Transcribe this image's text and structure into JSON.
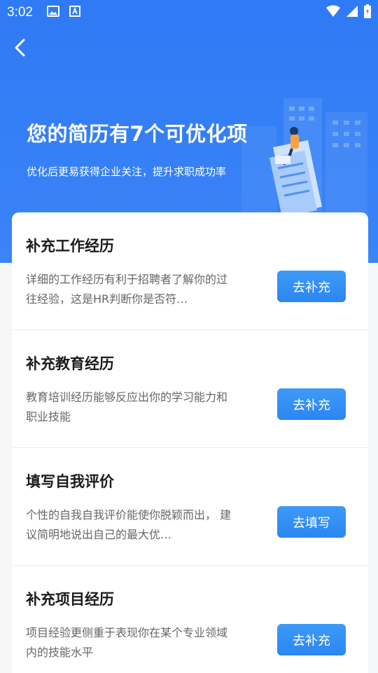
{
  "status_bar": {
    "time": "3:02"
  },
  "hero": {
    "title": "您的简历有7个可优化项",
    "subtitle": "优化后更易获得企业关注，提升求职成功率"
  },
  "items": [
    {
      "title": "补充工作经历",
      "desc": "详细的工作经历有利于招聘者了解你的过往经验，这是HR判断你是否符…",
      "button": "去补充"
    },
    {
      "title": "补充教育经历",
      "desc": "教育培训经历能够反应出你的学习能力和职业技能",
      "button": "去补充"
    },
    {
      "title": "填写自我评价",
      "desc": "个性的自我自我评价能使你脱颖而出， 建议简明地说出自己的最大优…",
      "button": "去填写"
    },
    {
      "title": "补充项目经历",
      "desc": "项目经验更侧重于表现你在某个专业领域内的技能水平",
      "button": "去补充"
    }
  ],
  "colors": {
    "primary": "#2f7af5",
    "button": "#2b86f0"
  }
}
